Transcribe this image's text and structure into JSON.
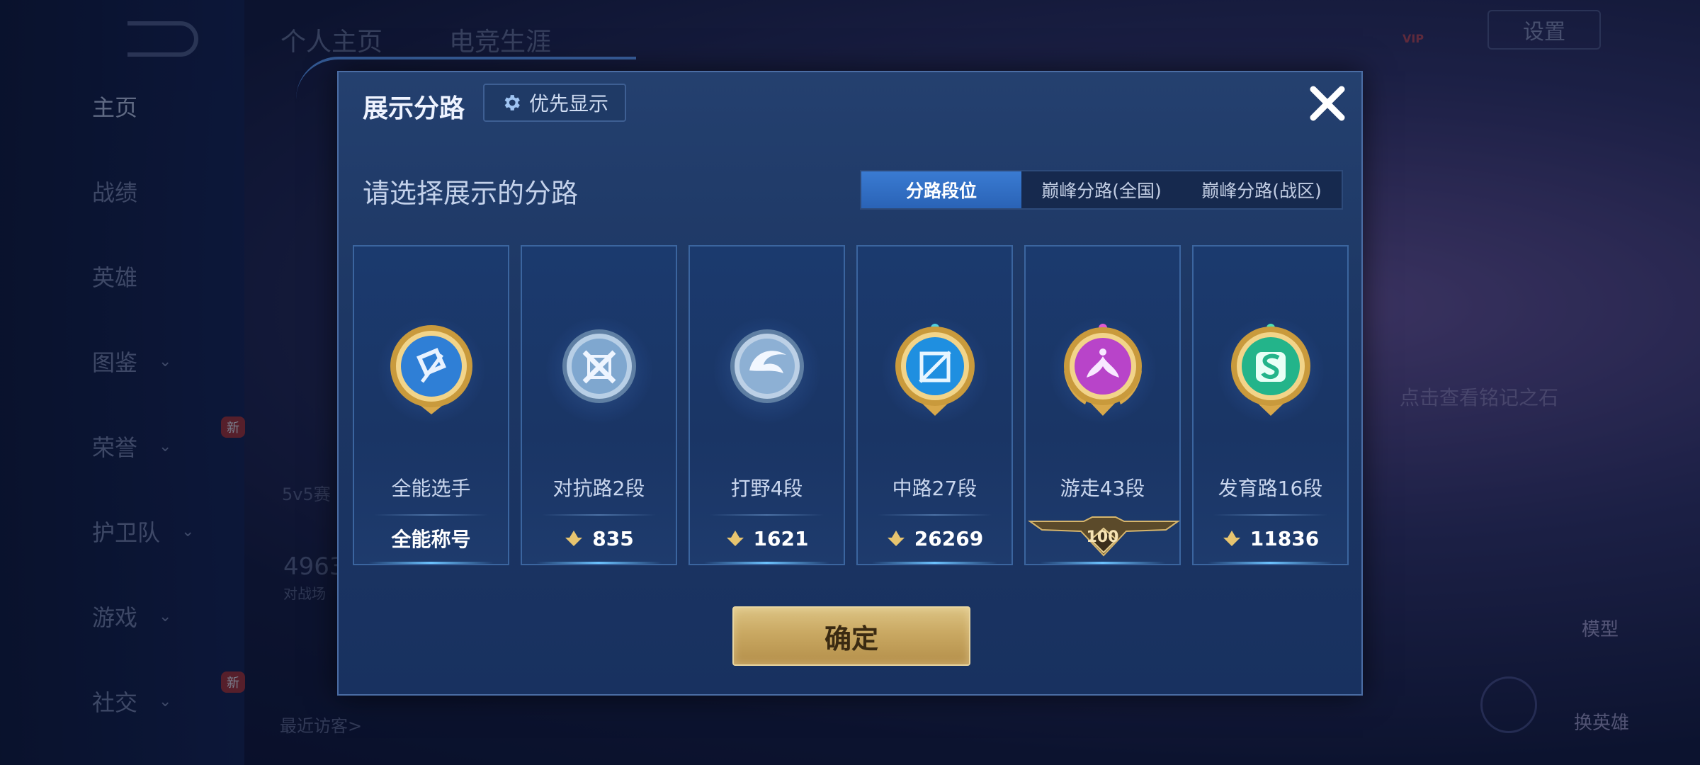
{
  "background": {
    "nav": [
      {
        "label": "主页",
        "chevron": false,
        "active": true
      },
      {
        "label": "战绩",
        "chevron": false
      },
      {
        "label": "英雄",
        "chevron": false
      },
      {
        "label": "图鉴",
        "chevron": true
      },
      {
        "label": "荣誉",
        "chevron": true,
        "badge": "新"
      },
      {
        "label": "护卫队",
        "chevron": true
      },
      {
        "label": "游戏",
        "chevron": true
      },
      {
        "label": "社交",
        "chevron": true,
        "badge": "新"
      }
    ],
    "top_tabs": [
      "个人主页",
      "电竞生涯"
    ],
    "settings_label": "设置",
    "vip_label": "VIP",
    "mode_text": "5v5赛",
    "stat_value": "4963",
    "stat_sub": "对战场",
    "recent_visitors": "最近访客>",
    "right_hint": "点击查看铭记之石",
    "model_label": "模型",
    "swap_hero_label": "换英雄"
  },
  "modal": {
    "title": "展示分路",
    "priority_button": "优先显示",
    "subtitle": "请选择展示的分路",
    "tabs": [
      {
        "label": "分路段位",
        "active": true
      },
      {
        "label": "巅峰分路(全国)",
        "active": false
      },
      {
        "label": "巅峰分路(战区)",
        "active": false
      }
    ],
    "cards": [
      {
        "label": "全能选手",
        "value": "全能称号",
        "emblem": "all-round-emblem-icon",
        "theme": "#2f7fd6"
      },
      {
        "label": "对抗路2段",
        "value": "835",
        "emblem": "clash-lane-emblem-icon",
        "theme": "#7fa7cf"
      },
      {
        "label": "打野4段",
        "value": "1621",
        "emblem": "jungle-emblem-icon",
        "theme": "#8db0d4"
      },
      {
        "label": "中路27段",
        "value": "26269",
        "emblem": "mid-lane-emblem-icon",
        "theme": "#1f8fe0"
      },
      {
        "label": "游走43段",
        "value": "100",
        "emblem": "roam-emblem-icon",
        "theme": "#b844c9"
      },
      {
        "label": "发育路16段",
        "value": "11836",
        "emblem": "farm-lane-emblem-icon",
        "theme": "#23b48a"
      }
    ],
    "confirm_button": "确定",
    "colors": {
      "accent": "#2f6fc7",
      "gold": "#c9a862"
    }
  }
}
